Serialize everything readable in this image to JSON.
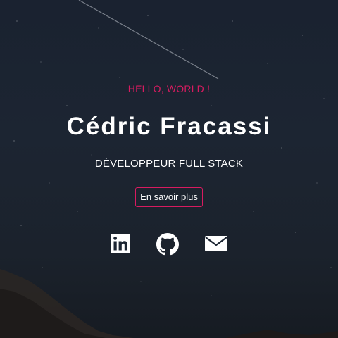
{
  "hero": {
    "greeting": "HELLO, WORLD !",
    "name": "Cédric Fracassi",
    "role": "DÉVELOPPEUR FULL STACK",
    "cta_label": "En savoir plus"
  },
  "social": [
    {
      "icon": "linkedin-icon"
    },
    {
      "icon": "github-icon"
    },
    {
      "icon": "email-icon"
    }
  ],
  "colors": {
    "accent": "#d81b60",
    "background": "#1c2532",
    "text": "#ffffff"
  }
}
